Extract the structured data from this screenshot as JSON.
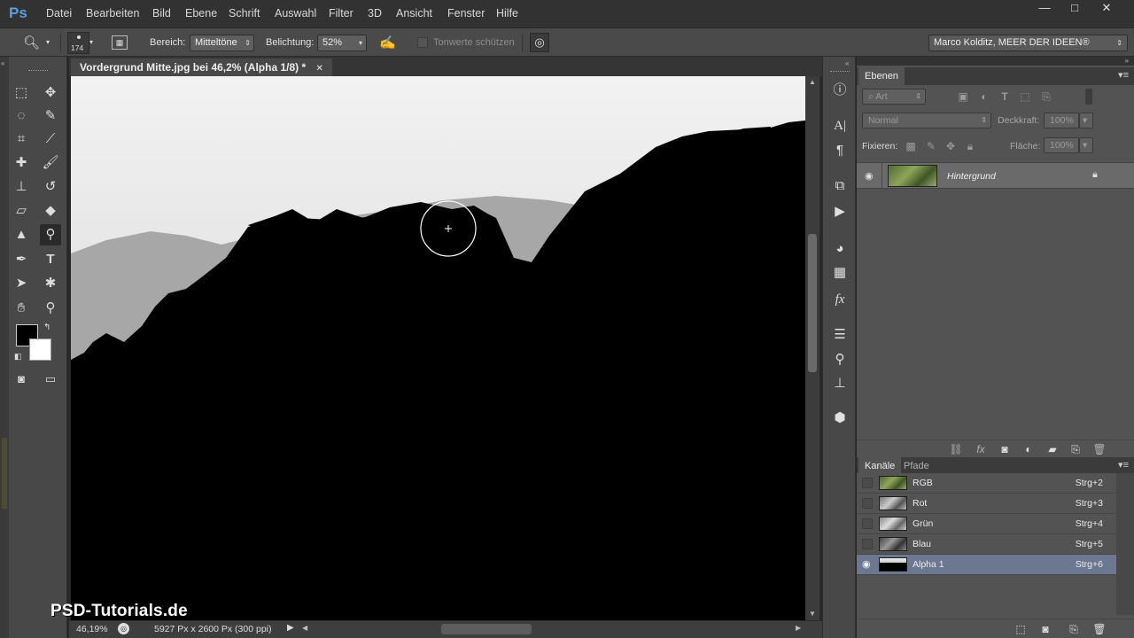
{
  "app": {
    "logo": "Ps"
  },
  "menu": [
    "Datei",
    "Bearbeiten",
    "Bild",
    "Ebene",
    "Schrift",
    "Auswahl",
    "Filter",
    "3D",
    "Ansicht",
    "Fenster",
    "Hilfe"
  ],
  "window_controls": {
    "minimize": "—",
    "maximize": "□",
    "close": "✕"
  },
  "options_bar": {
    "brush_size": "174",
    "range_label": "Bereich:",
    "range_value": "Mitteltöne",
    "exposure_label": "Belichtung:",
    "exposure_value": "52%",
    "protect_tones_label": "Tonwerte schützen",
    "workspace": "Marco Kolditz, MEER DER IDEEN®"
  },
  "document": {
    "tab_title": "Vordergrund Mitte.jpg bei 46,2% (Alpha 1/8) *",
    "tab_close": "✕"
  },
  "status": {
    "zoom": "46,19%",
    "dimensions": "5927 Px x 2600 Px (300 ppi)"
  },
  "layers_panel": {
    "tab": "Ebenen",
    "filter_kind": "Art",
    "blend_mode": "Normal",
    "opacity_label": "Deckkraft:",
    "opacity_value": "100%",
    "lock_label": "Fixieren:",
    "fill_label": "Fläche:",
    "fill_value": "100%",
    "layers": [
      {
        "name": "Hintergrund"
      }
    ]
  },
  "channels_panel": {
    "tabs": [
      "Kanäle",
      "Pfade"
    ],
    "channels": [
      {
        "name": "RGB",
        "shortcut": "Strg+2"
      },
      {
        "name": "Rot",
        "shortcut": "Strg+3"
      },
      {
        "name": "Grün",
        "shortcut": "Strg+4"
      },
      {
        "name": "Blau",
        "shortcut": "Strg+5"
      },
      {
        "name": "Alpha 1",
        "shortcut": "Strg+6"
      }
    ]
  },
  "watermark": "PSD-Tutorials.de",
  "colors": {
    "accent": "#5a9ee0",
    "selected_channel": "#6c7891"
  }
}
